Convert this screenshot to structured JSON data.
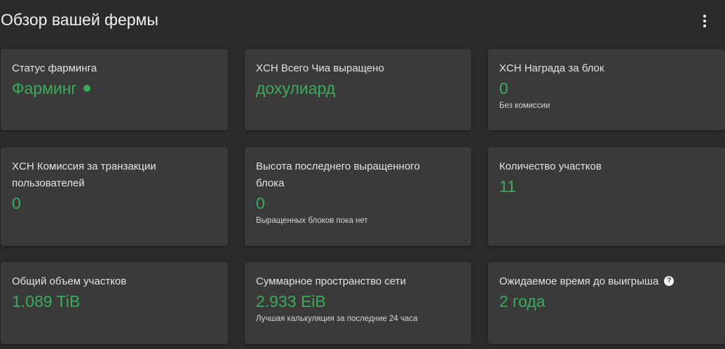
{
  "header": {
    "title": "Обзор вашей фермы",
    "more_icon": "more-vert-icon"
  },
  "colors": {
    "background": "#2b2b2b",
    "card": "#3a3a3a",
    "accent_green": "#3aac59"
  },
  "cards": {
    "farming_status": {
      "title": "Статус фарминга",
      "value": "Фарминг",
      "status_icon": "status-dot-icon"
    },
    "total_chia": {
      "title": "XCH Всего Чиа выращено",
      "value": "дохулиард"
    },
    "block_reward": {
      "title": "XCH Награда за блок",
      "value": "0",
      "sub": "Без комиссии"
    },
    "user_fees": {
      "title": "XCH Комиссия за транзакции пользователей",
      "value": "0"
    },
    "last_block_height": {
      "title": "Высота последнего выращенного блока",
      "value": "0",
      "sub": "Выращенных блоков пока нет"
    },
    "plot_count": {
      "title": "Количество участков",
      "value": "11"
    },
    "total_plot_size": {
      "title": "Общий объем участков",
      "value": "1.089 TiB"
    },
    "network_space": {
      "title": "Суммарное пространство сети",
      "value": "2.933 EiB",
      "sub": "Лучшая калькуляция за последние 24 часа"
    },
    "expected_time": {
      "title": "Ожидаемое время до выигрыша",
      "value": "2 года",
      "help_icon": "help-icon"
    }
  }
}
